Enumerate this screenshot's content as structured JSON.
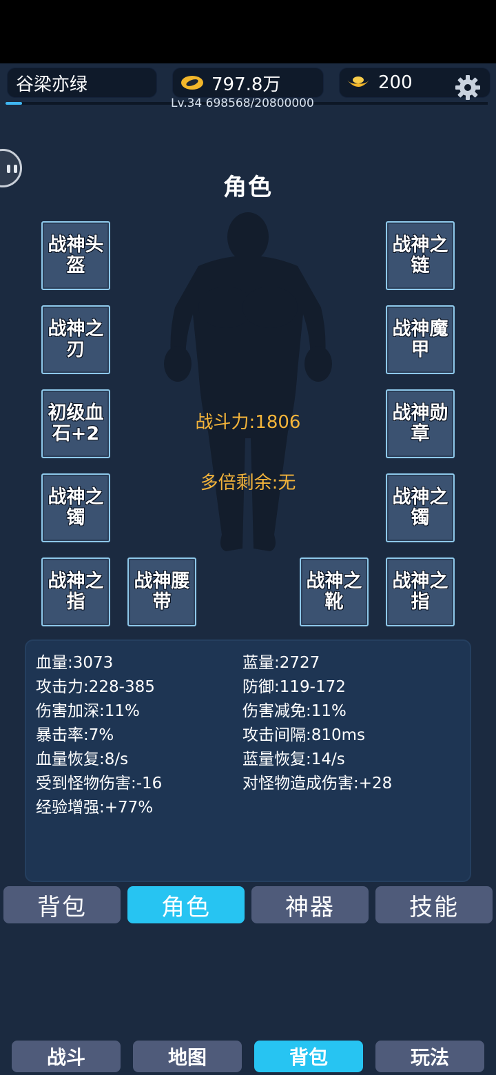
{
  "header": {
    "player_name": "谷梁亦绿",
    "gold": "797.8万",
    "ingot": "200",
    "level_exp": "Lv.34  698568/20800000",
    "exp_progress": 0.034,
    "icons": {
      "gold": "gold-coin-icon",
      "ingot": "gold-ingot-icon",
      "settings": "gear-icon"
    }
  },
  "panel": {
    "title": "角色",
    "combat_power": "战斗力:1806",
    "multiplier": "多倍剩余:无"
  },
  "equipment": {
    "left": [
      "战神头盔",
      "战神之刃",
      "初级血石+2",
      "战神之镯",
      "战神之指"
    ],
    "right": [
      "战神之链",
      "战神魔甲",
      "战神勋章",
      "战神之镯",
      "战神之指"
    ],
    "bottom_middle_left": "战神腰带",
    "bottom_middle_right": "战神之靴"
  },
  "stats": {
    "left": [
      "血量:3073",
      "攻击力:228-385",
      "伤害加深:11%",
      "暴击率:7%",
      "血量恢复:8/s",
      "受到怪物伤害:-16",
      "经验增强:+77%"
    ],
    "right": [
      "蓝量:2727",
      "防御:119-172",
      "伤害减免:11%",
      "攻击间隔:810ms",
      "蓝量恢复:14/s",
      "对怪物造成伤害:+28"
    ]
  },
  "tabs": [
    "背包",
    "角色",
    "神器",
    "技能"
  ],
  "active_tab": "角色",
  "bottom_nav": [
    "战斗",
    "地图",
    "背包",
    "玩法"
  ],
  "active_nav": "背包",
  "colors": {
    "accent": "#27c4f2",
    "gold_text": "#f4b43a",
    "background": "#1b2a40",
    "slot_border": "#8ec8ea"
  }
}
